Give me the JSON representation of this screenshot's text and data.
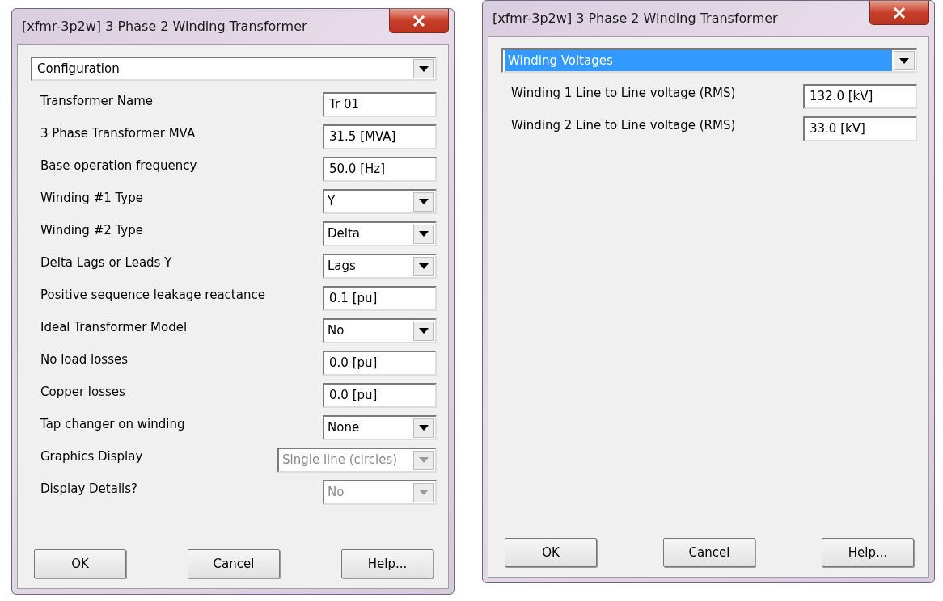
{
  "dialogs": [
    {
      "title": "[xfmr-3p2w] 3 Phase 2 Winding Transformer",
      "section": {
        "value": "Configuration",
        "selected": false
      },
      "fields": [
        {
          "label": "Transformer Name",
          "kind": "text",
          "value": "Tr 01",
          "disabled": false
        },
        {
          "label": "3 Phase Transformer MVA",
          "kind": "text",
          "value": "31.5 [MVA]",
          "disabled": false
        },
        {
          "label": "Base operation frequency",
          "kind": "text",
          "value": "50.0 [Hz]",
          "disabled": false
        },
        {
          "label": "Winding #1 Type",
          "kind": "select",
          "value": "Y",
          "disabled": false
        },
        {
          "label": "Winding #2 Type",
          "kind": "select",
          "value": "Delta",
          "disabled": false
        },
        {
          "label": "Delta Lags or Leads Y",
          "kind": "select",
          "value": "Lags",
          "disabled": false
        },
        {
          "label": "Positive sequence leakage reactance",
          "kind": "text",
          "value": "0.1 [pu]",
          "disabled": false
        },
        {
          "label": "Ideal Transformer Model",
          "kind": "select",
          "value": "No",
          "disabled": false
        },
        {
          "label": "No load losses",
          "kind": "text",
          "value": "0.0 [pu]",
          "disabled": false
        },
        {
          "label": "Copper losses",
          "kind": "text",
          "value": "0.0 [pu]",
          "disabled": false
        },
        {
          "label": "Tap changer on winding",
          "kind": "select",
          "value": "None",
          "disabled": false
        },
        {
          "label": "Graphics Display",
          "kind": "select",
          "value": "Single line (circles)",
          "disabled": true
        },
        {
          "label": "Display Details?",
          "kind": "select",
          "value": "No",
          "disabled": true
        }
      ],
      "buttons": [
        "OK",
        "Cancel",
        "Help..."
      ]
    },
    {
      "title": "[xfmr-3p2w] 3 Phase 2 Winding Transformer",
      "section": {
        "value": "Winding Voltages",
        "selected": true
      },
      "fields": [
        {
          "label": "Winding 1 Line to Line voltage (RMS)",
          "kind": "text",
          "value": "132.0 [kV]",
          "disabled": false
        },
        {
          "label": "Winding 2 Line to Line voltage (RMS)",
          "kind": "text",
          "value": "33.0 [kV]",
          "disabled": false
        }
      ],
      "buttons": [
        "OK",
        "Cancel",
        "Help..."
      ]
    }
  ]
}
